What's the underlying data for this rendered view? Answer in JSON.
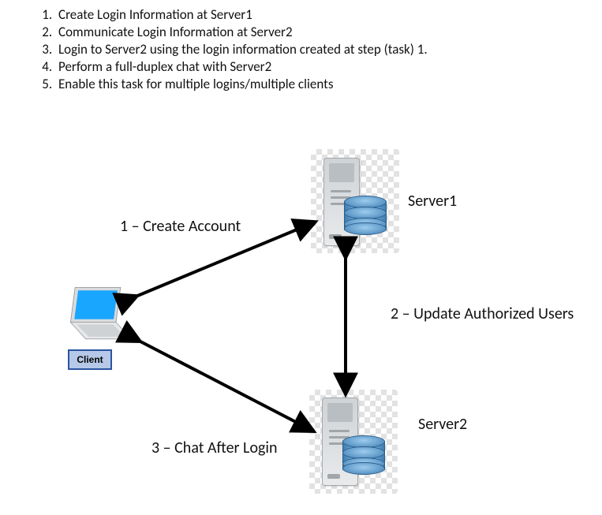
{
  "steps": [
    "Create Login Information at Server1",
    "Communicate Login Information at Server2",
    "Login to Server2 using the login information created at step (task) 1.",
    "Perform a full-duplex chat with Server2",
    "Enable this task for multiple logins/multiple clients"
  ],
  "diagram": {
    "client_label": "Client",
    "server1_label": "Server1",
    "server2_label": "Server2",
    "edge1": "1 – Create Account",
    "edge2": "2 – Update Authorized Users",
    "edge3": "3 – Chat After Login"
  }
}
